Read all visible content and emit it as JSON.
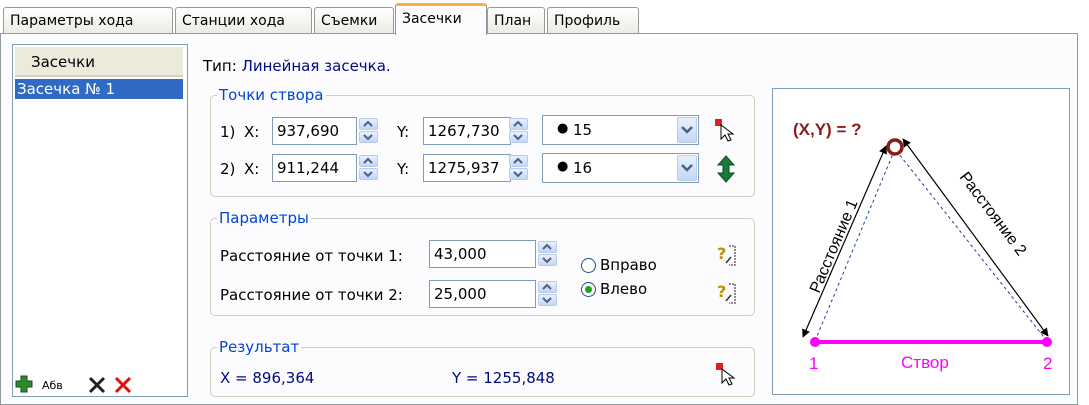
{
  "tabs": [
    "Параметры хода",
    "Станции хода",
    "Съемки",
    "Засечки",
    "План",
    "Профиль"
  ],
  "active_tab": "Засечки",
  "list": {
    "header": "Засечки",
    "items": [
      "Засечка № 1"
    ],
    "toolbar": {
      "add_icon": "plus-icon",
      "rename_label": "Абв",
      "delete_icon": "x-black-icon",
      "delete_all_icon": "x-red-icon"
    }
  },
  "type": {
    "label": "Тип:",
    "value": "Линейная засечка."
  },
  "points_group": {
    "title": "Точки створа",
    "rows": [
      {
        "num": "1)",
        "x_label": "X:",
        "x": "937,690",
        "y_label": "Y:",
        "y": "1267,730",
        "station": "15"
      },
      {
        "num": "2)",
        "x_label": "X:",
        "x": "911,244",
        "y_label": "Y:",
        "y": "1275,937",
        "station": "16"
      }
    ]
  },
  "params_group": {
    "title": "Параметры",
    "dist1_label": "Расстояние от точки 1:",
    "dist1": "43,000",
    "dist2_label": "Расстояние от точки 2:",
    "dist2": "25,000",
    "radio_right": "Вправо",
    "radio_left": "Влево",
    "selected": "Влево"
  },
  "result_group": {
    "title": "Результат",
    "x_text": "X = 896,364",
    "y_text": "Y = 1255,848"
  },
  "diagram": {
    "point_label": "(X,Y) = ?",
    "left_side": "Расстояние 1",
    "right_side": "Расстояние 2",
    "base_label": "Створ",
    "p1": "1",
    "p2": "2",
    "colors": {
      "magenta": "#ff00ff",
      "dark_red": "#8b1a1a"
    }
  }
}
